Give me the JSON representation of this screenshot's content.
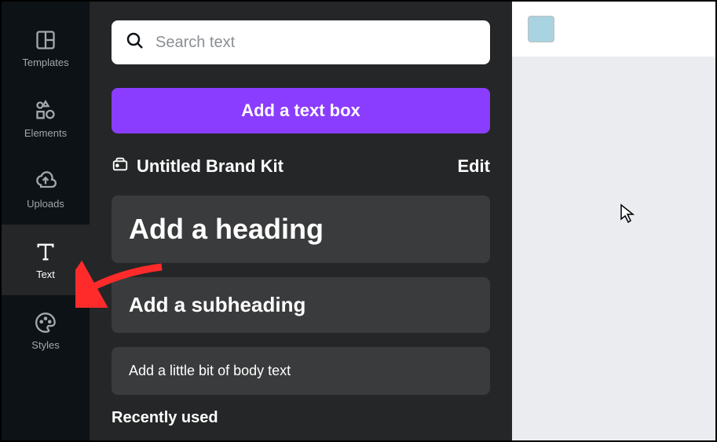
{
  "sidebar": {
    "items": [
      {
        "label": "Templates"
      },
      {
        "label": "Elements"
      },
      {
        "label": "Uploads"
      },
      {
        "label": "Text"
      },
      {
        "label": "Styles"
      }
    ]
  },
  "panel": {
    "search_placeholder": "Search text",
    "add_text_box": "Add a text box",
    "brand_kit_name": "Untitled Brand Kit",
    "edit_label": "Edit",
    "heading_label": "Add a heading",
    "subheading_label": "Add a subheading",
    "body_label": "Add a little bit of body text",
    "recent_title": "Recently used"
  },
  "canvas": {
    "swatch_color": "#a9d3e0"
  },
  "collapse_chevron": "‹"
}
